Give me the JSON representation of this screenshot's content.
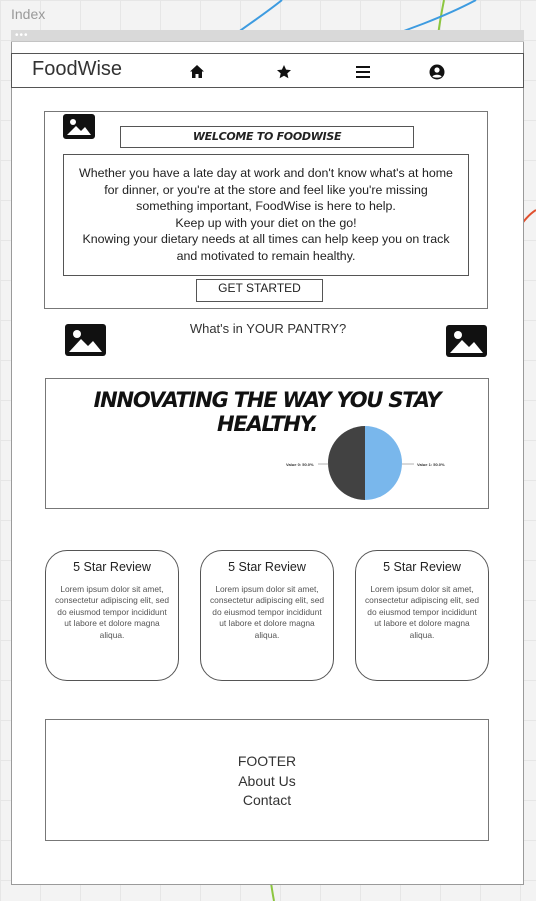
{
  "canvas": {
    "page_label": "Index"
  },
  "nav": {
    "brand": "FoodWise",
    "icons": [
      "home-icon",
      "star-icon",
      "menu-icon",
      "user-icon"
    ]
  },
  "hero": {
    "title": "WELCOME TO FOODWISE",
    "intro_lines": [
      "Whether you have a late day at work and don't know what's at home",
      "for dinner, or you're at the store and feel like you're missing",
      "something important, FoodWise is here to help.",
      "Keep up with your diet on the go!",
      "Knowing your dietary needs at all times can help keep you on track",
      "and motivated to remain healthy."
    ],
    "cta_label": "GET STARTED"
  },
  "pantry": {
    "text": "What's in YOUR PANTRY?"
  },
  "feature": {
    "title": "INNOVATING THE WAY YOU STAY HEALTHY.",
    "pie": {
      "slices": [
        {
          "label": "Value 0: 50.0%",
          "value": 50,
          "color": "#424242"
        },
        {
          "label": "Value 1: 50.0%",
          "value": 50,
          "color": "#79b7ec"
        }
      ]
    }
  },
  "reviews": [
    {
      "title": "5 Star Review",
      "body": "Lorem ipsum dolor sit amet, consectetur adipiscing elit, sed do eiusmod tempor incididunt ut labore et dolore magna aliqua."
    },
    {
      "title": "5 Star Review",
      "body": "Lorem ipsum dolor sit amet, consectetur adipiscing elit, sed do eiusmod tempor incididunt ut labore et dolore magna aliqua."
    },
    {
      "title": "5 Star Review",
      "body": "Lorem ipsum dolor sit amet, consectetur adipiscing elit, sed do eiusmod tempor incididunt ut labore et dolore magna aliqua."
    }
  ],
  "footer": {
    "label": "FOOTER",
    "about": "About Us",
    "contact": "Contact"
  },
  "colors": {
    "connector_blue": "#3d9be0",
    "connector_green": "#8cc63f",
    "connector_red": "#e0502f"
  }
}
